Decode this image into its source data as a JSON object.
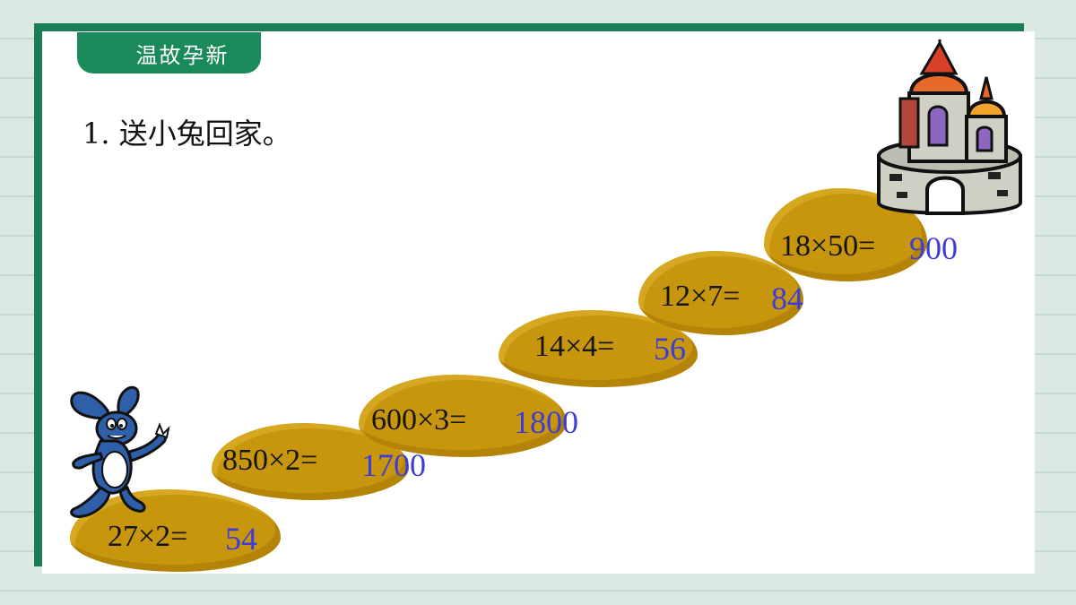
{
  "section_tag": "温故孕新",
  "question": "1. 送小兔回家。",
  "colors": {
    "frame": "#1b7d55",
    "rock": "#c8960c",
    "answer": "#3d3dd6",
    "text": "#151515"
  },
  "steps": [
    {
      "equation": "27×2=",
      "answer": "54"
    },
    {
      "equation": "850×2=",
      "answer": "1700"
    },
    {
      "equation": "600×3=",
      "answer": "1800"
    },
    {
      "equation": "14×4=",
      "answer": "56"
    },
    {
      "equation": "12×7=",
      "answer": "84"
    },
    {
      "equation": "18×50=",
      "answer": "900"
    }
  ],
  "icons": [
    "rabbit-icon",
    "castle-icon"
  ]
}
